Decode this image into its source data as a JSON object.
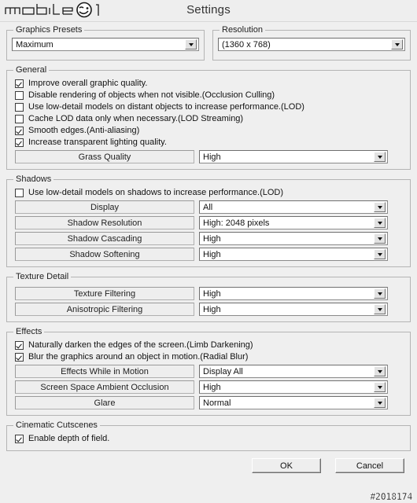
{
  "header": {
    "logo_text": "mobile01",
    "logo_icon": "winking-face-icon",
    "title": "Settings"
  },
  "graphics_presets": {
    "legend": "Graphics Presets",
    "value": "Maximum"
  },
  "resolution": {
    "legend": "Resolution",
    "value": "(1360 x 768)"
  },
  "general": {
    "legend": "General",
    "checkboxes": [
      {
        "label": "Improve overall graphic quality.",
        "checked": true
      },
      {
        "label": "Disable rendering of objects when not visible.(Occlusion Culling)",
        "checked": false
      },
      {
        "label": "Use low-detail models on distant objects to increase performance.(LOD)",
        "checked": false
      },
      {
        "label": "Cache LOD data only when necessary.(LOD Streaming)",
        "checked": false
      },
      {
        "label": "Smooth edges.(Anti-aliasing)",
        "checked": true
      },
      {
        "label": "Increase transparent lighting quality.",
        "checked": true
      }
    ],
    "rows": [
      {
        "name": "Grass Quality",
        "value": "High"
      }
    ]
  },
  "shadows": {
    "legend": "Shadows",
    "checkboxes": [
      {
        "label": "Use low-detail models on shadows to increase performance.(LOD)",
        "checked": false
      }
    ],
    "rows": [
      {
        "name": "Display",
        "value": "All"
      },
      {
        "name": "Shadow Resolution",
        "value": "High: 2048 pixels"
      },
      {
        "name": "Shadow Cascading",
        "value": "High"
      },
      {
        "name": "Shadow Softening",
        "value": "High"
      }
    ]
  },
  "texture_detail": {
    "legend": "Texture Detail",
    "rows": [
      {
        "name": "Texture Filtering",
        "value": "High"
      },
      {
        "name": "Anisotropic Filtering",
        "value": "High"
      }
    ]
  },
  "effects": {
    "legend": "Effects",
    "checkboxes": [
      {
        "label": "Naturally darken the edges of the screen.(Limb Darkening)",
        "checked": true
      },
      {
        "label": "Blur the graphics around an object in motion.(Radial Blur)",
        "checked": true
      }
    ],
    "rows": [
      {
        "name": "Effects While in Motion",
        "value": "Display All"
      },
      {
        "name": "Screen Space Ambient Occlusion",
        "value": "High"
      },
      {
        "name": "Glare",
        "value": "Normal"
      }
    ]
  },
  "cinematic_cutscenes": {
    "legend": "Cinematic Cutscenes",
    "checkboxes": [
      {
        "label": "Enable depth of field.",
        "checked": true
      }
    ]
  },
  "buttons": {
    "ok": "OK",
    "cancel": "Cancel"
  },
  "watermark": "#2018174",
  "colors": {
    "background": "#efefef",
    "group_border": "#b4b4b4",
    "field_bg": "#ffffff"
  }
}
